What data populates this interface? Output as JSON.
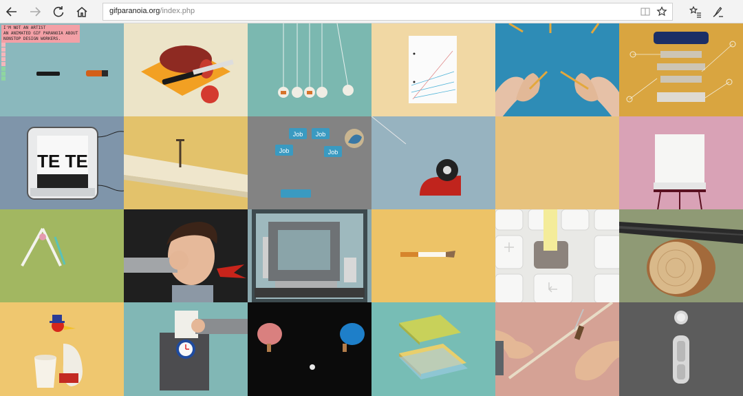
{
  "browser": {
    "url_domain": "gifparanoia.org",
    "url_path": "/index.php",
    "icons": {
      "back": "back-arrow-icon",
      "forward": "forward-arrow-icon",
      "refresh": "refresh-icon",
      "home": "home-icon",
      "reading_view": "reading-view-icon",
      "favorite": "star-icon",
      "favorites_hub": "favorites-hub-icon",
      "web_note": "pen-icon"
    }
  },
  "notice": {
    "line1": "I'M NOT AN ARTIST",
    "line2": "AN ANIMATED GIF PARANOIA ABOUT",
    "line3": "NONSTOP DESIGN WORKERS."
  },
  "tiles": {
    "printer_text": "TE TE",
    "job_labels": [
      "Job",
      "Job",
      "Job",
      "Job"
    ]
  },
  "colors": {
    "notice_bg": "#f3a0a6",
    "bar_pink": "#f5b6bb",
    "bar_green": "#8fd6a0"
  }
}
